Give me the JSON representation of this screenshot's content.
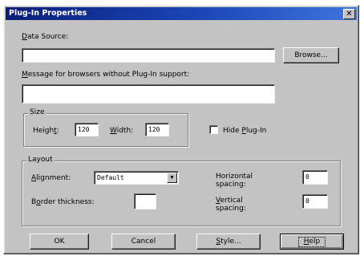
{
  "window": {
    "title": "Plug-In Properties",
    "close_glyph": "✕"
  },
  "data_source": {
    "label_underline": "D",
    "label_rest": "ata Source:",
    "value": "",
    "browse_label": "Browse..."
  },
  "message": {
    "label_underline": "M",
    "label_rest": "essage for browsers without Plug-In support:",
    "value": ""
  },
  "size": {
    "legend": "Size",
    "height_label_pre": "Heigh",
    "height_label_underline": "t",
    "height_label_post": ":",
    "height_value": "120",
    "width_label_underline": "W",
    "width_label_rest": "idth:",
    "width_value": "120"
  },
  "hide_plugin": {
    "label_pre": "Hide ",
    "label_underline": "P",
    "label_rest": "lug-In",
    "checked": false
  },
  "layout": {
    "legend": "Layout",
    "alignment_label_underline": "A",
    "alignment_label_rest": "lignment:",
    "alignment_value": "Default",
    "border_label_pre": "B",
    "border_label_underline": "o",
    "border_label_rest": "rder thickness:",
    "border_value": "",
    "horizontal_label_line1": "Horizontal",
    "horizontal_label_line2": "spacing:",
    "horizontal_value": "0",
    "vertical_label_underline": "V",
    "vertical_label_line1_rest": "ertical",
    "vertical_label_line2": "spacing:",
    "vertical_value": "0"
  },
  "buttons": {
    "ok": "OK",
    "cancel": "Cancel",
    "style_underline": "S",
    "style_rest": "tyle...",
    "help_underline": "H",
    "help_rest": "elp"
  }
}
